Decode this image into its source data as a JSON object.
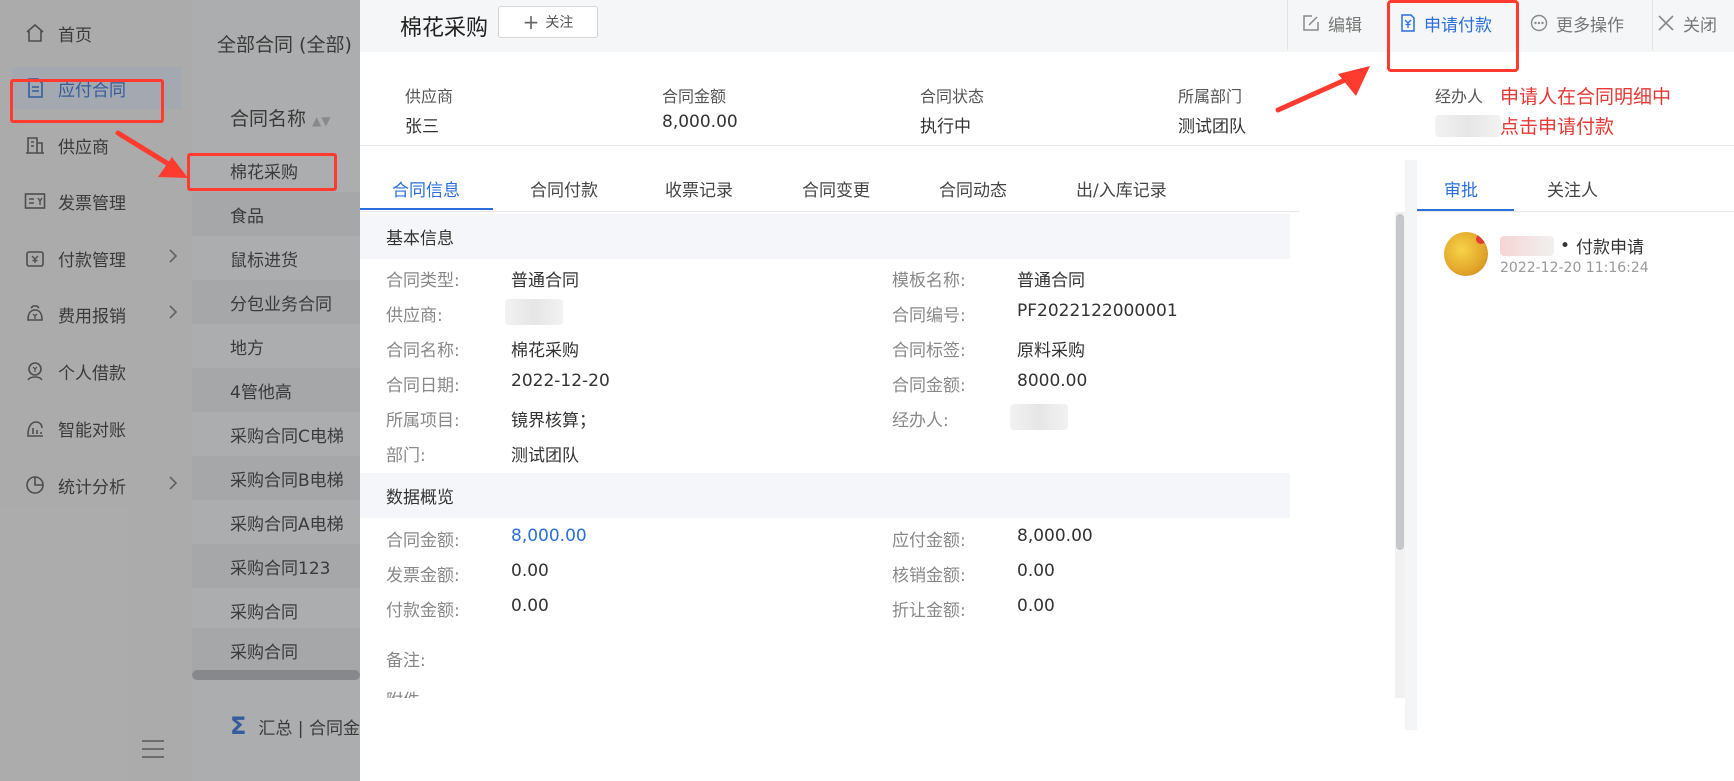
{
  "nav": {
    "items": [
      {
        "label": "首页",
        "icon": "home-icon"
      },
      {
        "label": "应付合同",
        "icon": "document-icon"
      },
      {
        "label": "供应商",
        "icon": "building-icon"
      },
      {
        "label": "发票管理",
        "icon": "invoice-icon"
      },
      {
        "label": "付款管理",
        "icon": "wallet-icon"
      },
      {
        "label": "费用报销",
        "icon": "money-bag-icon"
      },
      {
        "label": "个人借款",
        "icon": "person-coin-icon"
      },
      {
        "label": "智能对账",
        "icon": "reconcile-icon"
      },
      {
        "label": "统计分析",
        "icon": "pie-chart-icon"
      }
    ]
  },
  "list": {
    "title": "全部合同 (全部)",
    "column": "合同名称",
    "rows": [
      "棉花采购",
      "食品",
      "鼠标进货",
      "分包业务合同",
      "地方",
      "4管他高",
      "采购合同C电梯",
      "采购合同B电梯",
      "采购合同A电梯",
      "采购合同123",
      "采购合同",
      "采购合同"
    ],
    "summary": "汇总 | 合同金额"
  },
  "drawer": {
    "title": "棉花采购",
    "follow": "关注",
    "actions": {
      "edit": "编辑",
      "apply_pay": "申请付款",
      "more": "更多操作",
      "close": "关闭"
    },
    "summary": {
      "supplier_label": "供应商",
      "supplier_value": "张三",
      "amount_label": "合同金额",
      "amount_value": "8,000.00",
      "status_label": "合同状态",
      "status_value": "执行中",
      "dept_label": "所属部门",
      "dept_value": "测试团队",
      "handler_label": "经办人"
    },
    "annotation": {
      "line1": "申请人在合同明细中",
      "line2": "点击申请付款"
    },
    "tabs": [
      "合同信息",
      "合同付款",
      "收票记录",
      "合同变更",
      "合同动态",
      "出/入库记录"
    ],
    "basic": {
      "title": "基本信息",
      "fields": {
        "type_label": "合同类型:",
        "type_value": "普通合同",
        "template_label": "模板名称:",
        "template_value": "普通合同",
        "supplier_label": "供应商:",
        "code_label": "合同编号:",
        "code_value": "PF2022122000001",
        "name_label": "合同名称:",
        "name_value": "棉花采购",
        "tag_label": "合同标签:",
        "tag_value": "原料采购",
        "date_label": "合同日期:",
        "date_value": "2022-12-20",
        "amount_label": "合同金额:",
        "amount_value": "8000.00",
        "project_label": "所属项目:",
        "project_value": "镜界核算；",
        "handler_label": "经办人:",
        "dept_label": "部门:",
        "dept_value": "测试团队"
      }
    },
    "overview": {
      "title": "数据概览",
      "fields": {
        "contract_amount_label": "合同金额:",
        "contract_amount_value": "8,000.00",
        "payable_label": "应付金额:",
        "payable_value": "8,000.00",
        "invoice_label": "发票金额:",
        "invoice_value": "0.00",
        "writeoff_label": "核销金额:",
        "writeoff_value": "0.00",
        "paid_label": "付款金额:",
        "paid_value": "0.00",
        "discount_label": "折让金额:",
        "discount_value": "0.00"
      }
    },
    "remark_label": "备注:",
    "attachment_label": "附件",
    "right": {
      "tabs": [
        "审批",
        "关注人"
      ],
      "approval": {
        "title": "付款申请",
        "time": "2022-12-20 11:16:24"
      }
    }
  },
  "colors": {
    "accent": "#2a6fdb",
    "annotation": "#e53935"
  }
}
